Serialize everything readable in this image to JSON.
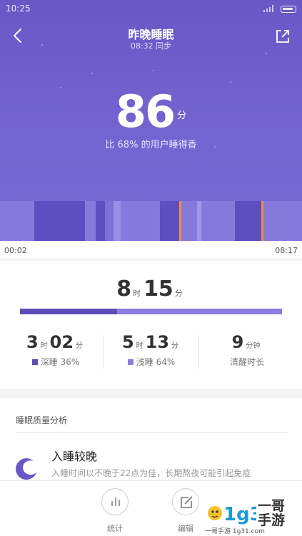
{
  "status_bar": {
    "time": "10:25"
  },
  "header": {
    "title": "昨晚睡眠",
    "sync_time": "08:32 同步"
  },
  "score": {
    "value": "86",
    "unit": "分",
    "compare": "比 68% 的用户睡得香"
  },
  "timeline": {
    "start": "00:02",
    "end": "08:17"
  },
  "totals": {
    "hours": "8",
    "hours_unit": "时",
    "minutes": "15",
    "minutes_unit": "分"
  },
  "ratio": {
    "deep_fraction": 0.37
  },
  "stats": [
    {
      "h": "3",
      "h_unit": "时",
      "m": "02",
      "m_unit": "分",
      "label": "深睡 36%",
      "color": "#5b4cb7"
    },
    {
      "h": "5",
      "h_unit": "时",
      "m": "13",
      "m_unit": "分",
      "label": "浅睡 64%",
      "color": "#8c7ce0"
    },
    {
      "value": "9",
      "unit": "分钟",
      "label": "清醒时长"
    }
  ],
  "analysis": {
    "heading": "睡眠质量分析",
    "tip_title": "入睡较晚",
    "tip_desc": "入睡时间以不晚于22点为佳，长期熬夜可能引起免疫"
  },
  "bottom_nav": [
    {
      "label": "统计",
      "icon": "bar-chart-icon"
    },
    {
      "label": "编辑",
      "icon": "edit-icon"
    }
  ],
  "watermark": {
    "brand": "1g31",
    "name_line1": "一哥",
    "name_line2": "手游",
    "url": "一哥手游 1g31.com"
  },
  "colors": {
    "deep": "#5b4cb7",
    "light": "#8c7ce0",
    "awake": "#f0913a",
    "hero": "#6a57c6"
  }
}
